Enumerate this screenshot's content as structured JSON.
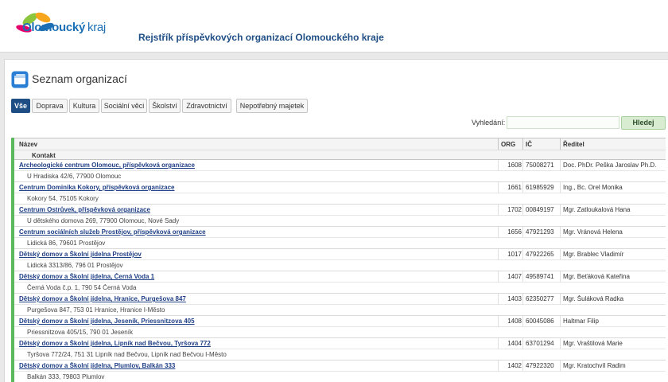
{
  "header": {
    "logo_text": "Olomoucký",
    "logo_suffix": "kraj",
    "title": "Rejstřík příspěvkových organizací Olomouckého kraje"
  },
  "section": {
    "title": "Seznam organizací"
  },
  "tabs": [
    {
      "label": "Vše",
      "active": true
    },
    {
      "label": "Doprava"
    },
    {
      "label": "Kultura"
    },
    {
      "label": "Sociální věci"
    },
    {
      "label": "Školství"
    },
    {
      "label": "Zdravotnictví"
    },
    {
      "label": "Nepotřebný majetek"
    }
  ],
  "search": {
    "label": "Vyhledání:",
    "value": "",
    "button": "Hledej"
  },
  "table": {
    "headers": {
      "name": "Název",
      "org": "ORG",
      "ic": "IČ",
      "director": "Ředitel",
      "contact": "Kontakt"
    },
    "rows": [
      {
        "name": "Archeologické centrum Olomouc, příspěvková organizace",
        "org": "1608",
        "ic": "75008271",
        "director": "Doc. PhDr. Peška Jaroslav Ph.D.",
        "address": "U Hradiska 42/6, 77900 Olomouc"
      },
      {
        "name": "Centrum Dominika Kokory, příspěvková organizace",
        "org": "1661",
        "ic": "61985929",
        "director": "Ing., Bc. Orel Monika",
        "address": "Kokory 54, 75105 Kokory"
      },
      {
        "name": "Centrum Ostrůvek, příspěvková organizace",
        "org": "1702",
        "ic": "00849197",
        "director": "Mgr. Zatloukalová Hana",
        "address": "U dětského domova 269, 77900 Olomouc, Nové Sady"
      },
      {
        "name": "Centrum sociálních služeb Prostějov, příspěvková organizace",
        "org": "1656",
        "ic": "47921293",
        "director": "Mgr. Vránová Helena",
        "address": "Lidická 86, 79601 Prostějov"
      },
      {
        "name": "Dětský domov a Školní jídelna Prostějov",
        "org": "1017",
        "ic": "47922265",
        "director": "Mgr. Brablec Vladimír",
        "address": "Lidická 3313/86, 796 01 Prostějov"
      },
      {
        "name": "Dětský domov a Školní jídelna, Černá Voda 1",
        "org": "1407",
        "ic": "49589741",
        "director": "Mgr. Beťáková Kateřina",
        "address": "Černá Voda č.p. 1, 790 54 Černá Voda"
      },
      {
        "name": "Dětský domov a Školní jídelna, Hranice, Purgešova 847",
        "org": "1403",
        "ic": "62350277",
        "director": "Mgr. Šuláková Radka",
        "address": "Purgešova 847, 753 01 Hranice, Hranice I-Město"
      },
      {
        "name": "Dětský domov a Školní jídelna, Jeseník, Priessnitzova 405",
        "org": "1408",
        "ic": "60045086",
        "director": "Haltmar Filip",
        "address": "Priessnitzova 405/15, 790 01 Jeseník"
      },
      {
        "name": "Dětský domov a Školní jídelna, Lipník nad Bečvou, Tyršova 772",
        "org": "1404",
        "ic": "63701294",
        "director": "Mgr. Vraštilová Marie",
        "address": "Tyršova 772/24, 751 31 Lipník nad Bečvou, Lipník nad Bečvou I-Město"
      },
      {
        "name": "Dětský domov a Školní jídelna, Plumlov, Balkán 333",
        "org": "1402",
        "ic": "47922320",
        "director": "Mgr. Kratochvíl Radim",
        "address": "Balkán 333, 79803 Plumlov"
      }
    ]
  },
  "colors": {
    "brand": "#1f4e85",
    "accent": "#5cb85c"
  },
  "icons": [
    "olomoucky-kraj-logo",
    "list-window-icon"
  ]
}
